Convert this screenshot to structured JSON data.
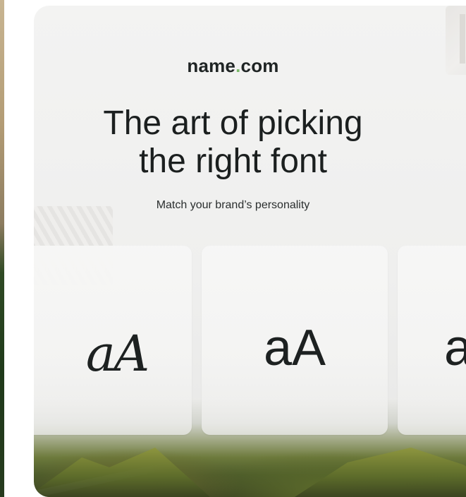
{
  "brand": {
    "name_part1": "name",
    "name_dot": ".",
    "name_part2": "com",
    "dot_color": "#7bb96a"
  },
  "hero": {
    "headline_line1": "The art of picking",
    "headline_line2": "the right font",
    "subheadline": "Match your brand’s personality"
  },
  "font_samples": [
    {
      "label": "aA",
      "style": "serif-italic"
    },
    {
      "label": "aA",
      "style": "sans-serif"
    },
    {
      "label": "a",
      "style": "sans-serif"
    }
  ],
  "colors": {
    "text": "#1b1f1f",
    "card_bg": "#f3f3f2",
    "landscape_green": "#6d7a3c"
  }
}
